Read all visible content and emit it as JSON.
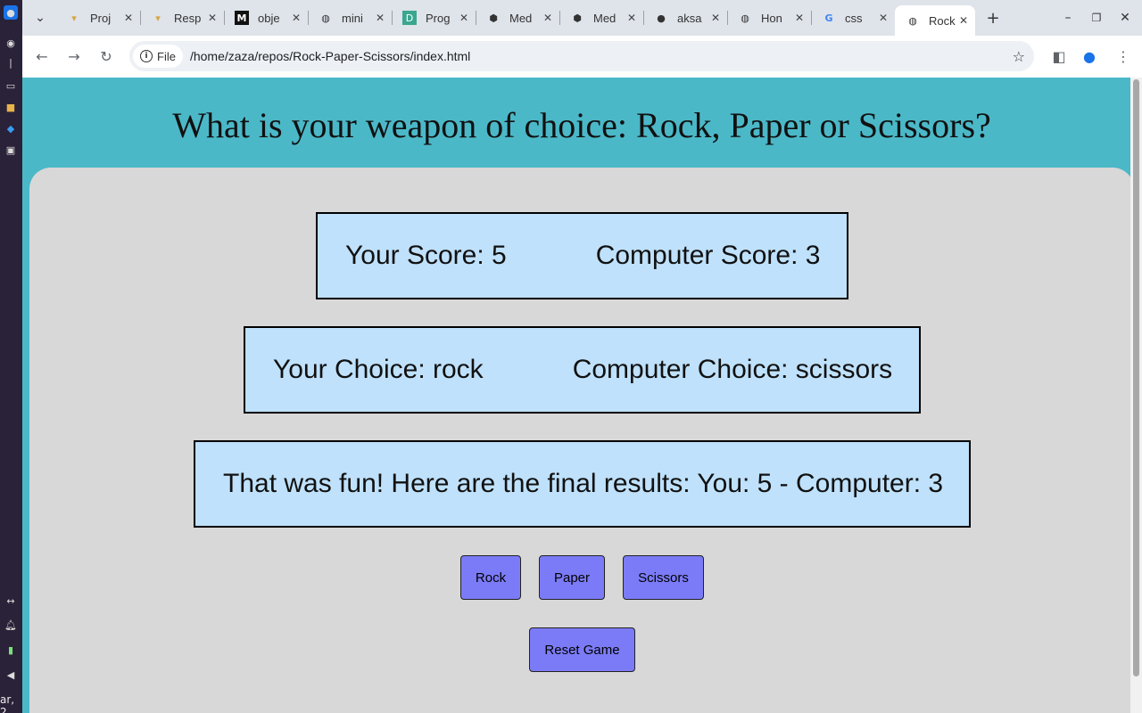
{
  "shelf": {
    "date": "ar, 2",
    "icons": [
      "app-launcher-icon",
      "chrome-icon",
      "files-icon",
      "folder-icon",
      "vscode-icon",
      "terminal-icon"
    ],
    "bottom_icons": [
      "screen-icon",
      "bell-icon",
      "battery-icon",
      "volume-icon"
    ]
  },
  "browser": {
    "tabs": [
      {
        "title": "Proj",
        "icon": "folder-icon"
      },
      {
        "title": "Resp",
        "icon": "folder-icon"
      },
      {
        "title": "obje",
        "icon": "m-icon"
      },
      {
        "title": "mini",
        "icon": "globe-icon"
      },
      {
        "title": "Prog",
        "icon": "d-icon"
      },
      {
        "title": "Med",
        "icon": "hex-icon"
      },
      {
        "title": "Med",
        "icon": "hex-icon"
      },
      {
        "title": "aksa",
        "icon": "github-icon"
      },
      {
        "title": "Hon",
        "icon": "globe-icon"
      },
      {
        "title": "css",
        "icon": "google-icon"
      },
      {
        "title": "Rock",
        "icon": "globe-icon"
      }
    ],
    "chip_label": "File",
    "url": "/home/zaza/repos/Rock-Paper-Scissors/index.html"
  },
  "game": {
    "question": "What is your weapon of choice: Rock, Paper or Scissors?",
    "your_score": "Your Score: 5",
    "computer_score": "Computer Score: 3",
    "your_choice": "Your Choice: rock",
    "computer_choice": "Computer Choice: scissors",
    "result": "That was fun! Here are the final results: You: 5 - Computer: 3",
    "rock_label": "Rock",
    "paper_label": "Paper",
    "scissors_label": "Scissors",
    "reset_label": "Reset Game"
  },
  "colors": {
    "page_bg": "#4bb8c8",
    "panel_bg": "#d8d8d8",
    "box_bg": "#bfe1fb",
    "button_bg": "#7b7bf8"
  }
}
